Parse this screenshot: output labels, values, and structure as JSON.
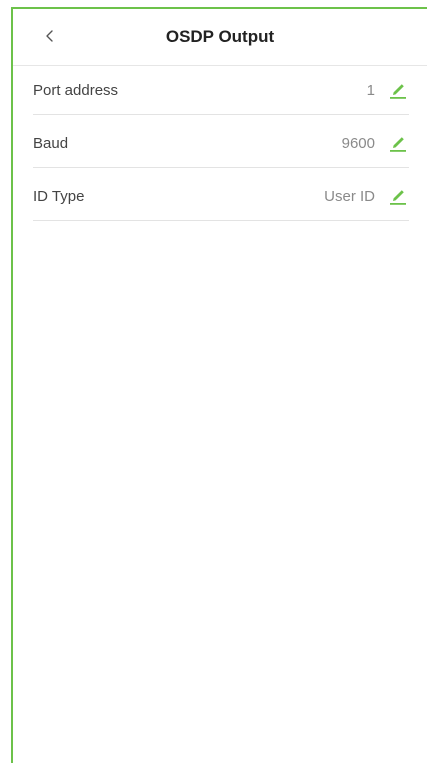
{
  "header": {
    "title": "OSDP Output",
    "back_icon": "chevron-left-icon"
  },
  "settings": [
    {
      "label": "Port address",
      "value": "1",
      "action_icon": "edit-pencil-icon"
    },
    {
      "label": "Baud",
      "value": "9600",
      "action_icon": "edit-pencil-icon"
    },
    {
      "label": "ID Type",
      "value": "User ID",
      "action_icon": "edit-pencil-icon"
    }
  ],
  "colors": {
    "accent": "#6cc24a",
    "label": "#444444",
    "value": "#8a8a8a",
    "divider": "#e3e3e3"
  }
}
